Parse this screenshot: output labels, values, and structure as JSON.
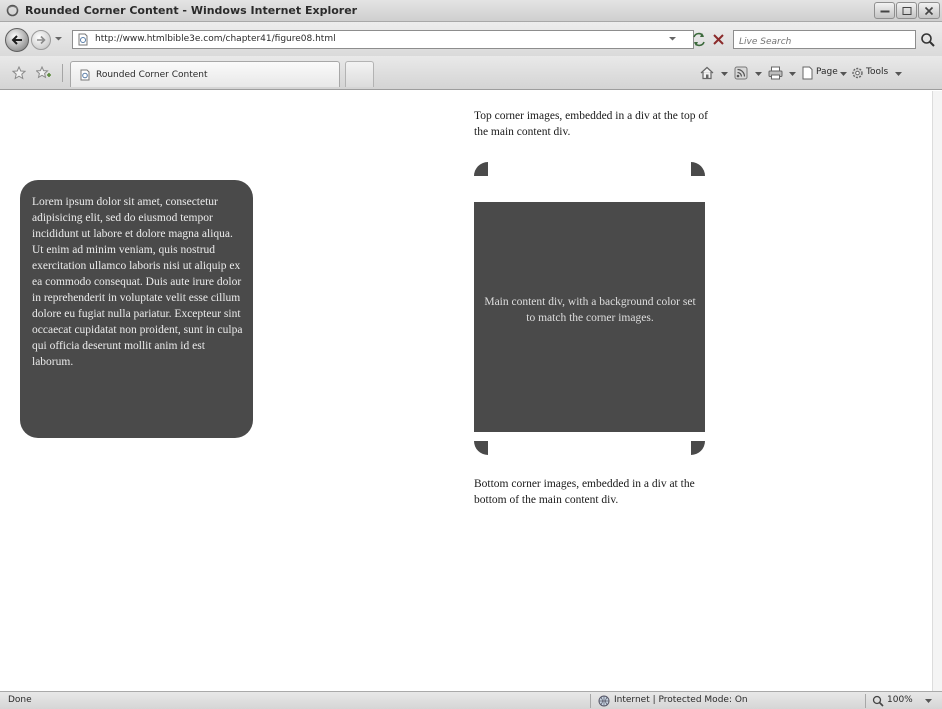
{
  "window": {
    "title": "Rounded Corner Content - Windows Internet Explorer"
  },
  "address_bar": {
    "url": "http://www.htmlbible3e.com/chapter41/figure08.html",
    "search_placeholder": "Live Search"
  },
  "tab_bar": {
    "active_tab_label": "Rounded Corner Content",
    "commands": {
      "page_label": "Page",
      "tools_label": "Tools"
    }
  },
  "content": {
    "rounded_box_text": "Lorem ipsum dolor sit amet, consectetur adipisicing elit, sed do eiusmod tempor incididunt ut labore et dolore magna aliqua. Ut enim ad minim veniam, quis nostrud exercitation ullamco laboris nisi ut aliquip ex ea commodo consequat. Duis aute irure dolor in reprehenderit in voluptate velit esse cillum dolore eu fugiat nulla pariatur. Excepteur sint occaecat cupidatat non proident, sunt in culpa qui officia deserunt mollit anim id est laborum.",
    "top_caption": "Top corner images, embedded in a div at the top of the main content div.",
    "main_text": "Main content div, with a background color set to match the corner images.",
    "bottom_caption": "Bottom corner images, embedded in a div at the bottom of the main content div.",
    "box_color": "#4a4a4a"
  },
  "status_bar": {
    "status": "Done",
    "zone": "Internet | Protected Mode: On",
    "zoom": "100%"
  },
  "icons": {
    "app": "ie-icon",
    "back": "back-arrow-icon",
    "forward": "forward-arrow-icon",
    "refresh": "refresh-icon",
    "stop": "stop-icon",
    "search": "search-icon",
    "favorites": "favorites-star-icon",
    "add_favorites": "add-favorites-icon",
    "home": "home-icon",
    "feeds": "feeds-icon",
    "print": "print-icon",
    "page": "page-icon",
    "tools": "tools-gear-icon",
    "zone": "globe-icon",
    "zoom": "zoom-icon"
  }
}
